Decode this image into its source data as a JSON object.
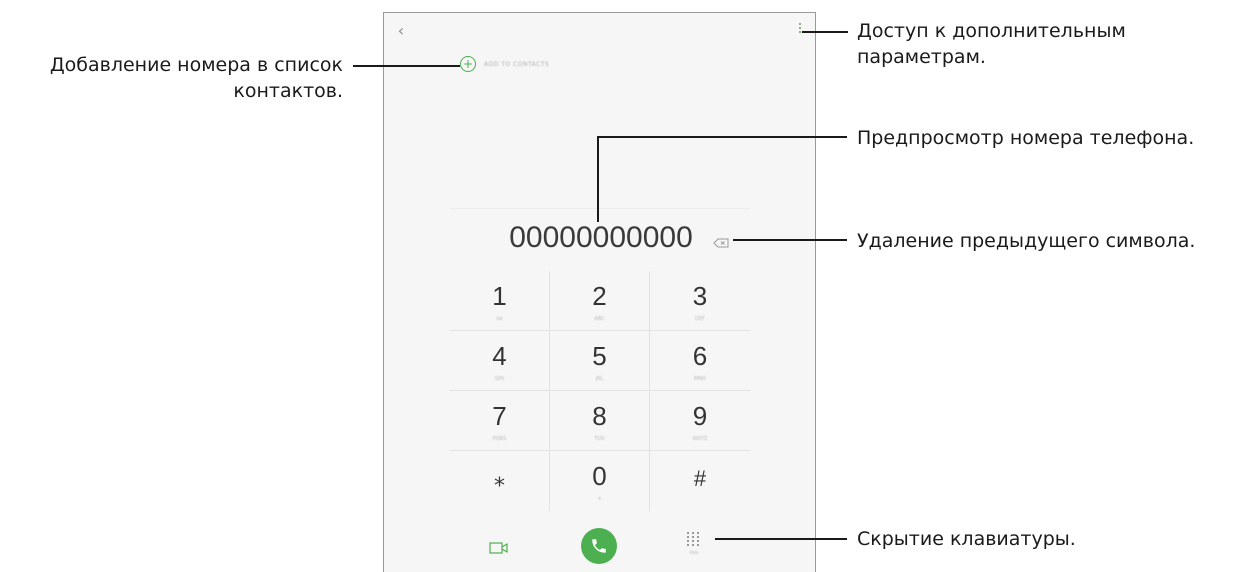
{
  "phone": {
    "add_contacts_label": "ADD TO CONTACTS",
    "number_preview": "00000000000",
    "keys": [
      {
        "digit": "1",
        "sub": "oo"
      },
      {
        "digit": "2",
        "sub": "ABC"
      },
      {
        "digit": "3",
        "sub": "DEF"
      },
      {
        "digit": "4",
        "sub": "GHI"
      },
      {
        "digit": "5",
        "sub": "JKL"
      },
      {
        "digit": "6",
        "sub": "MNO"
      },
      {
        "digit": "7",
        "sub": "PQRS"
      },
      {
        "digit": "8",
        "sub": "TUV"
      },
      {
        "digit": "9",
        "sub": "WXYZ"
      },
      {
        "digit": "⁎",
        "sub": ""
      },
      {
        "digit": "0",
        "sub": "+"
      },
      {
        "digit": "#",
        "sub": ""
      }
    ],
    "hide_keypad_label": "Hide",
    "accent_color": "#4caf50"
  },
  "callouts": {
    "add_to_contacts": [
      "Добавление номера в список",
      "контактов."
    ],
    "more_options": [
      "Доступ к дополнительным",
      "параметрам."
    ],
    "number_preview": "Предпросмотр номера телефона.",
    "delete_char": "Удаление предыдущего символа.",
    "hide_keypad": "Скрытие клавиатуры."
  }
}
